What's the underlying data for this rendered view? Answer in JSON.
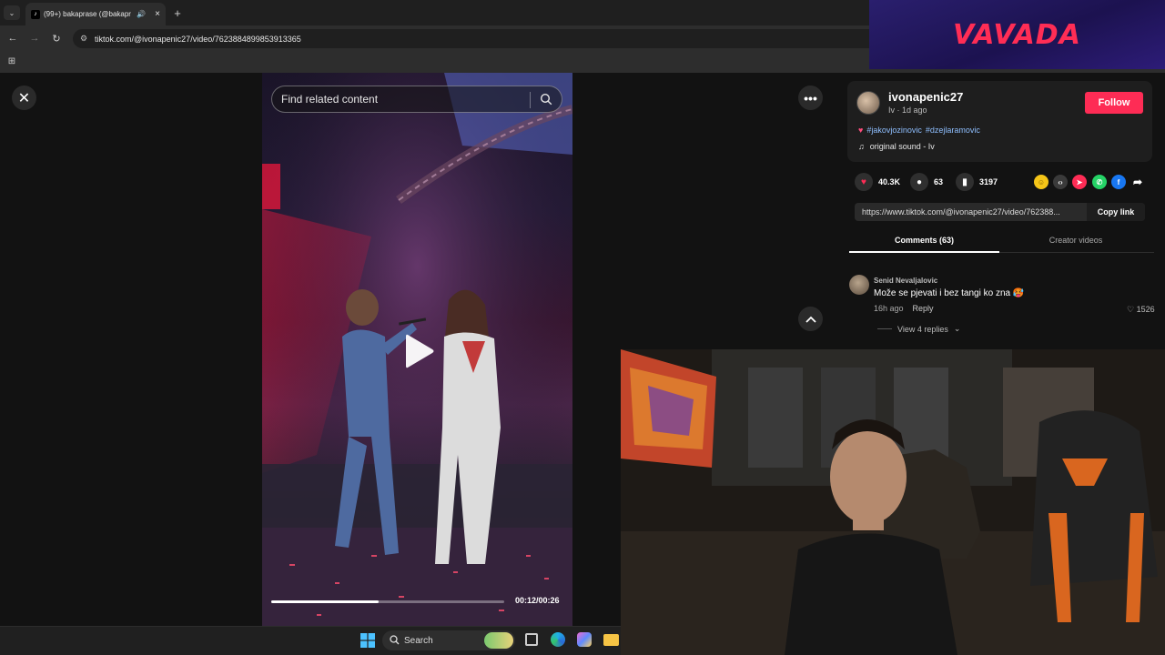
{
  "browser": {
    "tab_title": "(99+) bakaprase (@bakapr",
    "new_tab": "+",
    "address": "tiktok.com/@ivonapenic27/video/7623884899853913365"
  },
  "ad": {
    "brand": "VAVADA"
  },
  "player": {
    "search_placeholder": "Find related content",
    "time": "00:12/00:26",
    "progress": 0.46
  },
  "post": {
    "username": "ivonapenic27",
    "nickname_time": "Iv · 1d ago",
    "follow_label": "Follow",
    "hashtags": [
      "#jakovjozinovic",
      "#dzejlaramovic"
    ],
    "sound": "original sound - Iv",
    "likes": "40.3K",
    "comments": "63",
    "saves": "3197",
    "link": "https://www.tiktok.com/@ivonapenic27/video/762388...",
    "copy_label": "Copy link"
  },
  "tabs": {
    "comments": "Comments (63)",
    "creator": "Creator videos"
  },
  "comment": {
    "author": "Senid Nevaljalovic",
    "text": "Može se pjevati i bez tangi ko zna 🥵",
    "time": "16h ago",
    "reply": "Reply",
    "likes": "1526",
    "view_replies": "View 4 replies"
  },
  "taskbar": {
    "search_label": "Search"
  },
  "colors": {
    "accent": "#fe2c55",
    "hashtag": "#8fbfff"
  }
}
